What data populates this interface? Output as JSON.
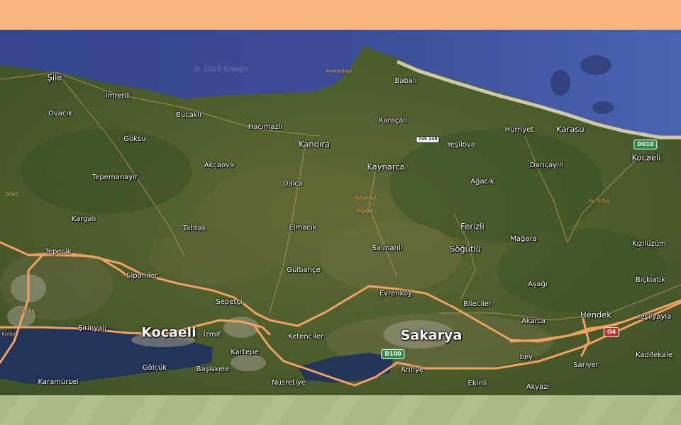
{
  "map": {
    "watermark": "© 2025 Google",
    "cities_major": [
      "Kocaeli",
      "Sakarya"
    ],
    "towns": [
      "Şile",
      "İmrenli",
      "Ovacık",
      "Bucaklı",
      "Hacımazlı",
      "Babalı",
      "Karaçalı",
      "Hürriyet",
      "Karasu",
      "Kocaeli",
      "Göksu",
      "Kandıra",
      "Yeşilova",
      "Akçaova",
      "Kaynarca",
      "Ağacık",
      "Darıçayırı",
      "Tepemanayır",
      "Dalca",
      "Kargalı",
      "Tahtalı",
      "Elmacık",
      "Ferizli",
      "Mağara",
      "Salmanlı",
      "Söğütlü",
      "Kızılüzüm",
      "Tepecik",
      "Sipahiler",
      "Gülbahçe",
      "Bıçkıatik",
      "Evrenköy",
      "Sepetçi",
      "Bileciler",
      "Aşağı",
      "Hendek",
      "Akarca",
      "Yeşilyayla",
      "Şirinyalı",
      "İzmit",
      "Ketenciler",
      "bey",
      "Kartepe",
      "Sarıyer",
      "Kadifekale",
      "Gölcük",
      "Başiskele",
      "Arifiye",
      "Karamürsel",
      "Nusretiye",
      "Ekinli",
      "Akyazı"
    ],
    "tiny_labels": [
      "Pembekay",
      "GÖKÇ",
      "Köyiköyü",
      "Aşağıdü",
      "Kurtuluş",
      "Gölcük",
      "Kalay"
    ],
    "shields": {
      "d010": "D010",
      "o4": "O4",
      "d100": "D100",
      "local": "745 248"
    },
    "colors": {
      "sea": "#3b4f93",
      "land": "#4a5a2a",
      "roads": "#f2a25e",
      "beach": "#cfc7a7"
    }
  }
}
